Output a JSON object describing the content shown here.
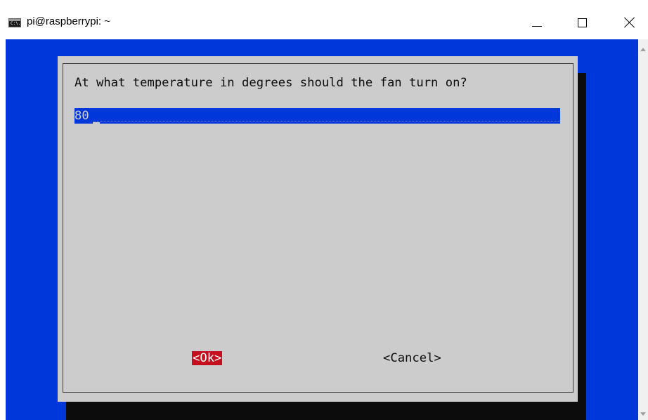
{
  "window": {
    "title": "pi@raspberrypi: ~",
    "icon": "console-icon",
    "icon_glyph": "C:\\."
  },
  "dialog": {
    "prompt": "At what temperature in degrees should the fan turn on?",
    "input_value": "80",
    "ok_label": "<Ok>",
    "cancel_label": "<Cancel>"
  },
  "colors": {
    "terminal_background": "#0037da",
    "dialog_background": "#cccccc",
    "dialog_shadow": "#0c0c0c",
    "selected_button": "#c50f1f"
  }
}
